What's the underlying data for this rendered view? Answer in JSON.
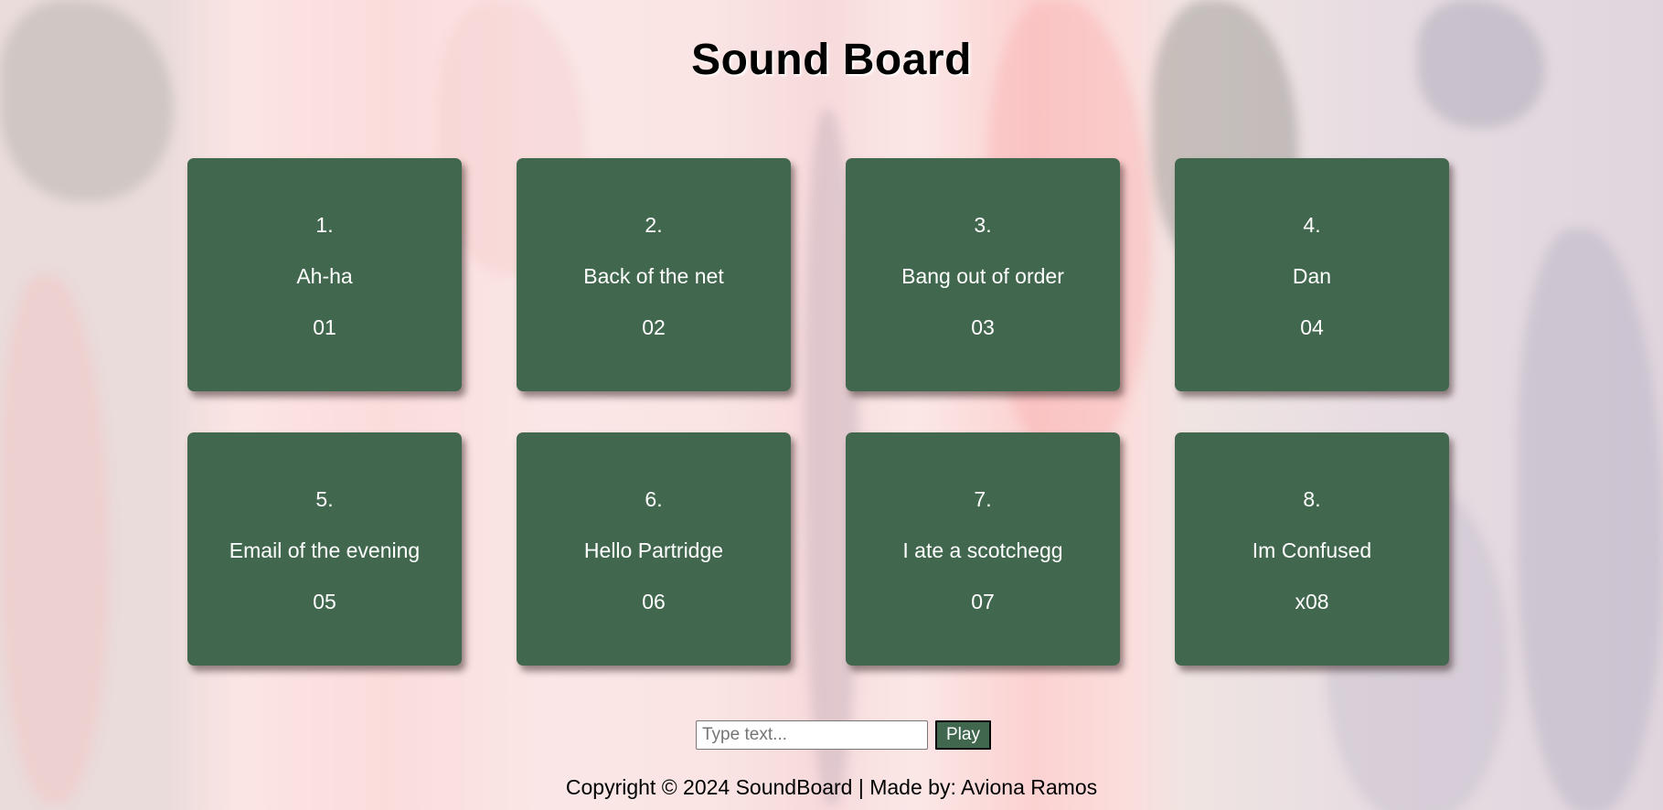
{
  "page": {
    "title": "Sound Board",
    "background": "pink-grey brush-stroke painting texture"
  },
  "colors": {
    "card_bg": "#41684e",
    "card_text": "#ffffff",
    "title_text": "#000000"
  },
  "cards": [
    {
      "number": "1.",
      "label": "Ah-ha",
      "code": "01"
    },
    {
      "number": "2.",
      "label": "Back of the net",
      "code": "02"
    },
    {
      "number": "3.",
      "label": "Bang out of order",
      "code": "03"
    },
    {
      "number": "4.",
      "label": "Dan",
      "code": "04"
    },
    {
      "number": "5.",
      "label": "Email of the evening",
      "code": "05"
    },
    {
      "number": "6.",
      "label": "Hello Partridge",
      "code": "06"
    },
    {
      "number": "7.",
      "label": "I ate a scotchegg",
      "code": "07"
    },
    {
      "number": "8.",
      "label": "Im Confused",
      "code": "x08"
    }
  ],
  "controls": {
    "input_value": "",
    "input_placeholder": "Type text...",
    "play_label": "Play"
  },
  "footer": {
    "text": "Copyright © 2024 SoundBoard | Made by: Aviona Ramos"
  }
}
